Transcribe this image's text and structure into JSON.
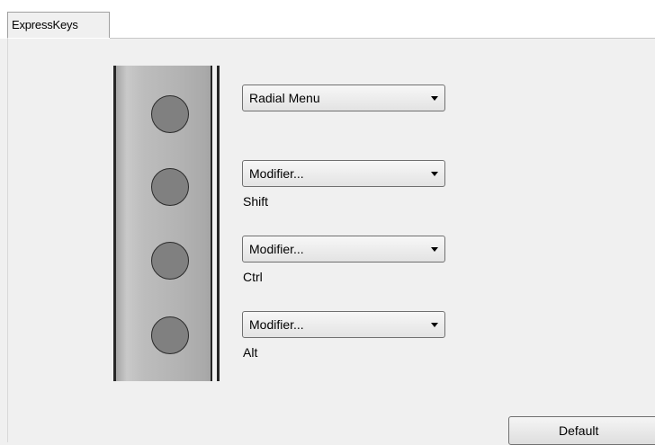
{
  "tabs": [
    {
      "label": "ExpressKeys",
      "active": true
    }
  ],
  "express_keys": [
    {
      "function": "Radial Menu",
      "modifier": ""
    },
    {
      "function": "Modifier...",
      "modifier": "Shift"
    },
    {
      "function": "Modifier...",
      "modifier": "Ctrl"
    },
    {
      "function": "Modifier...",
      "modifier": "Alt"
    }
  ],
  "buttons": {
    "default_label": "Default"
  },
  "icons": {
    "dropdown": "chevron-down-icon",
    "express_key": "circle-button-icon"
  },
  "colors": {
    "panel_background": "#f0f0f0",
    "key_fill": "#808080"
  }
}
